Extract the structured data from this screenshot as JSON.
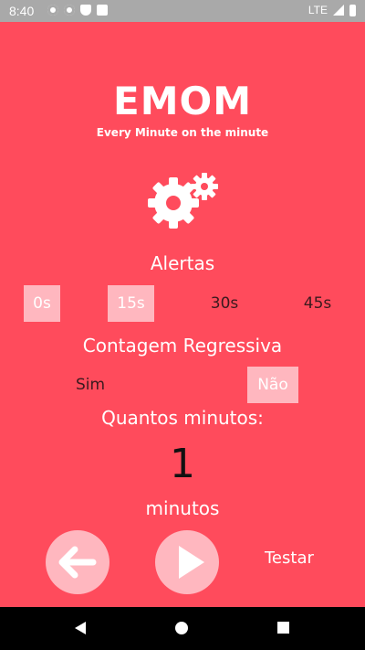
{
  "status_bar": {
    "time": "8:40",
    "network": "LTE"
  },
  "app": {
    "title": "EMOM",
    "subtitle": "Every Minute on the minute"
  },
  "alerts": {
    "label": "Alertas",
    "options": [
      "0s",
      "15s",
      "30s",
      "45s"
    ],
    "selected": [
      "0s",
      "15s"
    ]
  },
  "countdown": {
    "label": "Contagem Regressiva",
    "options": [
      "Sim",
      "Não"
    ],
    "selected": "Não"
  },
  "minutes": {
    "label": "Quantos minutos:",
    "value": "1",
    "unit": "minutos"
  },
  "controls": {
    "back_icon": "arrow-left-icon",
    "play_icon": "play-icon",
    "test_label": "Testar"
  },
  "colors": {
    "background": "#ff4b5c",
    "selected_option": "#ffb7bf",
    "accent_light": "#ffb7bf"
  }
}
